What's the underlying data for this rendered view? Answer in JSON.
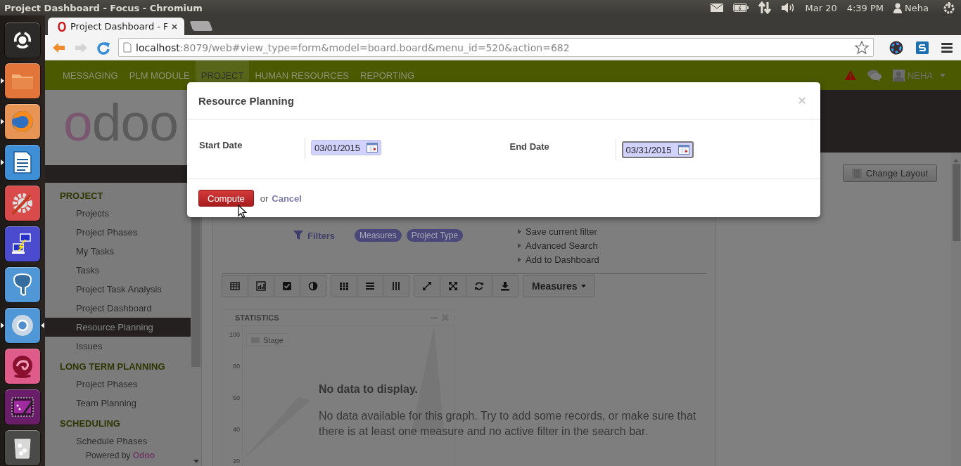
{
  "system_bar": {
    "window_title": "Project Dashboard - Focus - Chromium",
    "date": "Mar 20",
    "time": "4:39 PM",
    "user": "Neha"
  },
  "launcher": [
    {
      "kind": "dash",
      "running": false,
      "focused": false
    },
    {
      "kind": "files",
      "running": true,
      "focused": false
    },
    {
      "kind": "firefox",
      "running": true,
      "focused": false
    },
    {
      "kind": "writer",
      "running": true,
      "focused": false
    },
    {
      "kind": "settings",
      "running": false,
      "focused": false
    },
    {
      "kind": "remote",
      "running": false,
      "focused": false
    },
    {
      "kind": "database",
      "running": false,
      "focused": false
    },
    {
      "kind": "chromium",
      "running": true,
      "focused": true
    },
    {
      "kind": "swirl",
      "running": false,
      "focused": false
    },
    {
      "kind": "video",
      "running": false,
      "focused": false
    },
    {
      "kind": "trash",
      "running": false,
      "focused": false
    }
  ],
  "browser": {
    "tabs": [
      {
        "title": "Project Dashboard - F",
        "selected": true
      }
    ],
    "nav_buttons": [
      {
        "kind": "back",
        "disabled": false
      },
      {
        "kind": "forward",
        "disabled": true
      },
      {
        "kind": "reload",
        "disabled": false
      }
    ],
    "url_host": "localhost",
    "url_rest": ":8079/web#view_type=form&model=board.board&menu_id=520&action=682"
  },
  "top_menu": [
    {
      "label": "MESSAGING",
      "selected": false
    },
    {
      "label": "PLM MODULE",
      "selected": false
    },
    {
      "label": "PROJECT",
      "selected": true
    },
    {
      "label": "HUMAN RESOURCES",
      "selected": false
    },
    {
      "label": "REPORTING",
      "selected": false
    }
  ],
  "user_menu": {
    "name": "NEHA"
  },
  "logo": {
    "accent": "o",
    "rest": "doo"
  },
  "sidebar": {
    "sections": [
      {
        "title": "PROJECT",
        "items": [
          {
            "label": "Projects",
            "selected": false
          },
          {
            "label": "Project Phases",
            "selected": false
          },
          {
            "label": "My Tasks",
            "selected": false
          },
          {
            "label": "Tasks",
            "selected": false
          },
          {
            "label": "Project Task Analysis",
            "selected": false
          },
          {
            "label": "Project Dashboard",
            "selected": false
          },
          {
            "label": "Resource Planning",
            "selected": true
          },
          {
            "label": "Issues",
            "selected": false
          }
        ]
      },
      {
        "title": "LONG TERM PLANNING",
        "items": [
          {
            "label": "Project Phases",
            "selected": false
          },
          {
            "label": "Team Planning",
            "selected": false
          }
        ]
      },
      {
        "title": "SCHEDULING",
        "items": [
          {
            "label": "Schedule Phases",
            "selected": false
          }
        ]
      }
    ],
    "footer_text": "Powered by",
    "footer_link": "Odoo"
  },
  "dashboard": {
    "change_layout": "Change Layout",
    "search": {
      "filters_label": "Filters",
      "tags": [
        "Measures",
        "Project Type"
      ],
      "actions": [
        "Save current filter",
        "Advanced Search",
        "Add to Dashboard"
      ]
    },
    "view_button_groups": [
      [
        {
          "kind": "table"
        },
        {
          "kind": "bar-chart"
        },
        {
          "kind": "checkbox"
        },
        {
          "kind": "contrast"
        }
      ],
      [
        {
          "kind": "grid"
        },
        {
          "kind": "list"
        },
        {
          "kind": "columns"
        }
      ],
      [
        {
          "kind": "expand"
        },
        {
          "kind": "fullscreen"
        },
        {
          "kind": "refresh"
        },
        {
          "kind": "download"
        }
      ]
    ],
    "measures_button": "Measures",
    "widget": {
      "title": "STATISTICS",
      "legend": "Stage",
      "y_ticks": [
        "100",
        "80",
        "60",
        "40",
        "20"
      ]
    },
    "empty_title": "No data to display.",
    "empty_text": "No data available for this graph. Try to add some records, or make sure that there is at least one measure and no active filter in the search bar."
  },
  "dialog": {
    "title": "Resource Planning",
    "fields": [
      {
        "label": "Start Date",
        "value": "03/01/2015",
        "focused": false
      },
      {
        "label": "End Date",
        "value": "03/31/2015",
        "focused": true
      }
    ],
    "primary_button": "Compute",
    "separator": "or",
    "cancel": "Cancel"
  }
}
